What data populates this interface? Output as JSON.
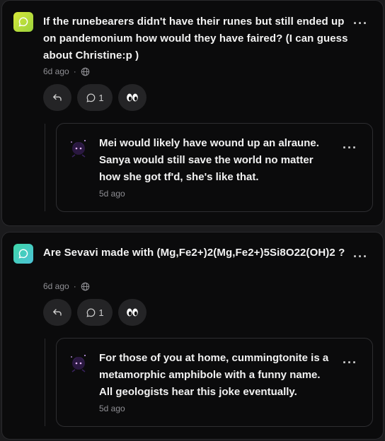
{
  "posts": [
    {
      "text": "If the runebearers didn't have their runes but still ended up on pandemonium how would they have faired? (I can guess about Christine:p )",
      "time": "6d ago",
      "comment_count": "1",
      "accent": "#c6e03a",
      "reply": {
        "text": "Mei would likely have wound up an alraune. Sanya would still save the world no matter how she got tf'd, she's like that.",
        "time": "5d ago"
      }
    },
    {
      "text": "Are Sevavi made with (Mg,Fe2+)2(Mg,Fe2+)5Si8O22(OH)2 ?",
      "time": "6d ago",
      "comment_count": "1",
      "accent": "#3ed1b0",
      "reply": {
        "text": "For those of you at home, cummingtonite is a metamorphic amphibole with a funny name. All geologists hear this joke eventually.",
        "time": "5d ago"
      }
    }
  ],
  "icons": {
    "more": "···",
    "globe": "globe-icon",
    "reply": "reply-icon",
    "comment": "comment-icon",
    "eyes": "eyes-icon",
    "bubble": "chat-bubble-icon",
    "avatar": "avatar"
  }
}
